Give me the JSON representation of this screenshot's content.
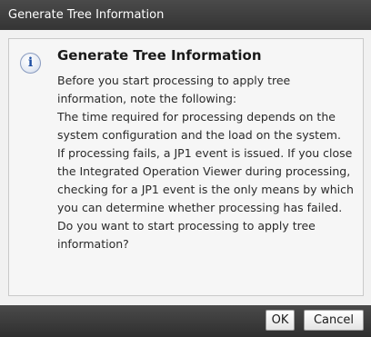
{
  "window": {
    "title": "Generate Tree Information"
  },
  "dialog": {
    "icon": "info-icon",
    "heading": "Generate Tree Information",
    "paragraphs": [
      "Before you start processing to apply tree information, note the following:",
      "The time required for processing depends on the system configuration and the load on the system.",
      "If processing fails, a JP1 event is issued. If you close the Integrated Operation Viewer during processing, checking for a JP1 event is the only means by which you can determine whether processing has failed.",
      "Do you want to start processing to apply tree information?"
    ]
  },
  "buttons": {
    "ok_label": "OK",
    "cancel_label": "Cancel"
  }
}
